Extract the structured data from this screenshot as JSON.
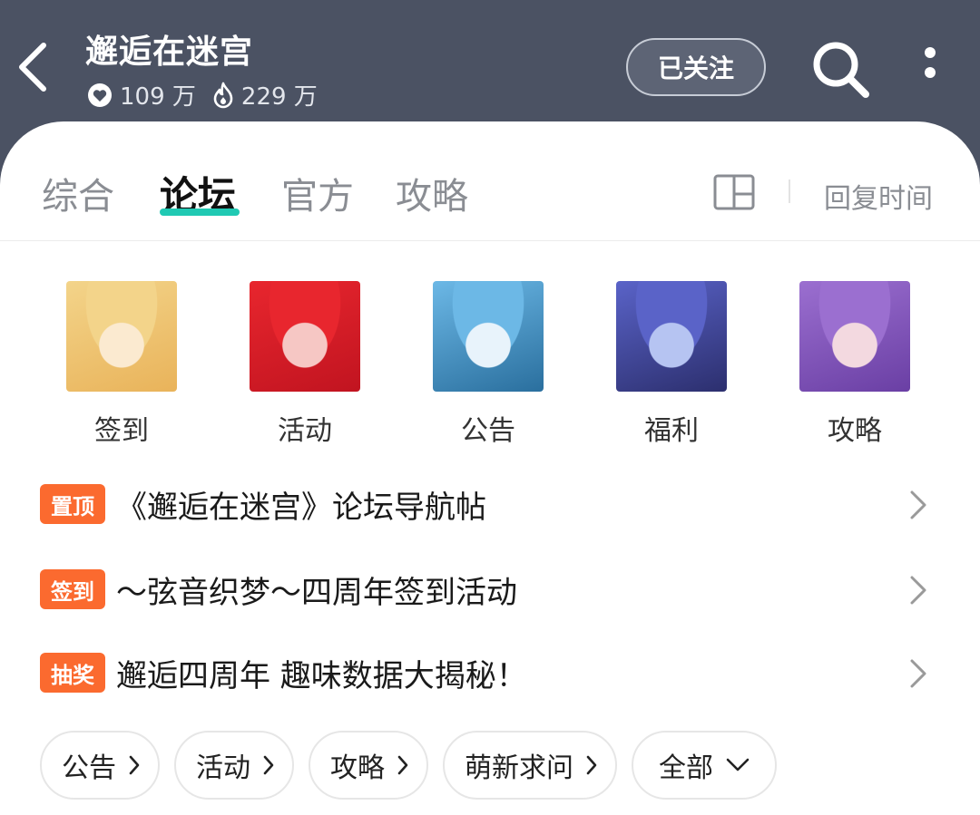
{
  "header": {
    "title": "邂逅在迷宫",
    "likes": "109 万",
    "heat": "229 万",
    "follow_label": "已关注"
  },
  "tabs": [
    {
      "label": "综合",
      "active": false
    },
    {
      "label": "论坛",
      "active": true
    },
    {
      "label": "官方",
      "active": false
    },
    {
      "label": "攻略",
      "active": false
    }
  ],
  "sort_label": "回复时间",
  "shortcuts": [
    {
      "label": "签到",
      "colors": [
        "#f3d48a",
        "#e9b35a",
        "#fbead0"
      ]
    },
    {
      "label": "活动",
      "colors": [
        "#e8262e",
        "#c11420",
        "#f6c7c4"
      ]
    },
    {
      "label": "公告",
      "colors": [
        "#6cb8e6",
        "#2a6f9e",
        "#e8f3fb"
      ]
    },
    {
      "label": "福利",
      "colors": [
        "#5a63c8",
        "#2c2f6e",
        "#b6c4f2"
      ]
    },
    {
      "label": "攻略",
      "colors": [
        "#9b6fd0",
        "#6a3fa4",
        "#f3d9e0"
      ]
    }
  ],
  "posts": [
    {
      "badge": "置顶",
      "title": "《邂逅在迷宫》论坛导航帖"
    },
    {
      "badge": "签到",
      "title": "～弦音织梦～四周年签到活动"
    },
    {
      "badge": "抽奖",
      "title": "邂逅四周年 趣味数据大揭秘！"
    }
  ],
  "chips": [
    "公告",
    "活动",
    "攻略",
    "萌新求问",
    "全部"
  ],
  "colors": {
    "header_bg": "#4b5263",
    "accent": "#20c9b3",
    "badge": "#fb6a2f"
  }
}
